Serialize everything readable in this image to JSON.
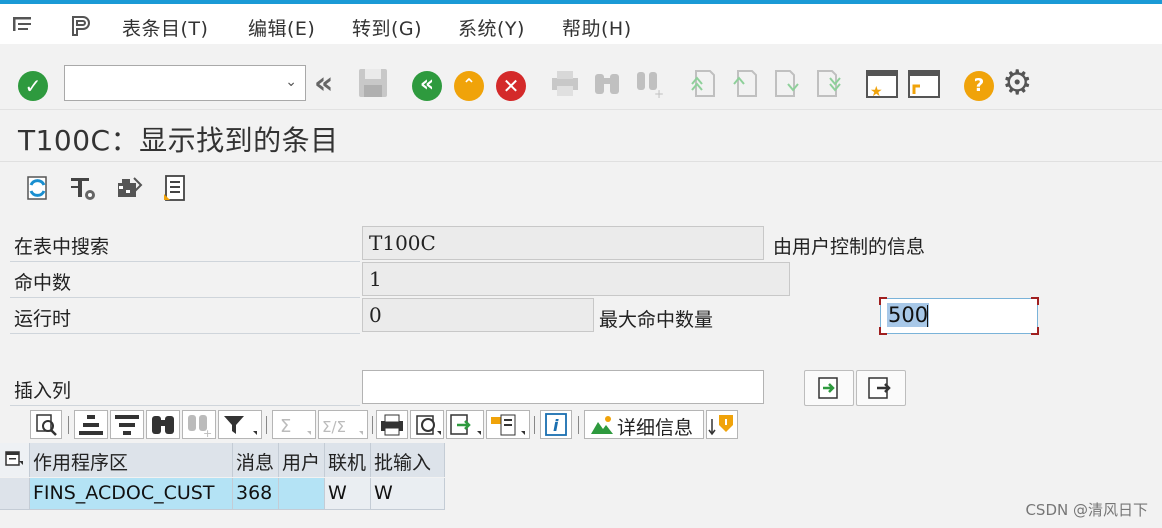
{
  "menu": {
    "items": [
      {
        "label": "表条目(T)"
      },
      {
        "label": "编辑(E)"
      },
      {
        "label": "转到(G)"
      },
      {
        "label": "系统(Y)"
      },
      {
        "label": "帮助(H)"
      }
    ]
  },
  "toolbar": {
    "command_field_value": ""
  },
  "title": "T100C：显示找到的条目",
  "form": {
    "search_table_label": "在表中搜索",
    "search_table_value": "T100C",
    "user_controlled_label": "由用户控制的信息",
    "hits_label": "命中数",
    "hits_value": "1",
    "runtime_label": "运行时",
    "runtime_value": "0",
    "max_hits_label": "最大命中数量",
    "max_hits_value": "500",
    "insert_column_label": "插入列",
    "insert_column_value": ""
  },
  "grid_toolbar": {
    "detail_label": "详细信息"
  },
  "grid": {
    "columns": [
      "作用程序区",
      "消息",
      "用户",
      "联机",
      "批输入"
    ],
    "rows": [
      [
        "FINS_ACDOC_CUST",
        "368",
        "",
        "W",
        "W"
      ]
    ]
  },
  "watermark": "CSDN @清风日下",
  "colors": {
    "accent": "#1a9ad6",
    "green": "#2e9a3e",
    "orange": "#f0a30a",
    "red": "#d42a2a",
    "selection_cell": "#b4e3f5"
  }
}
